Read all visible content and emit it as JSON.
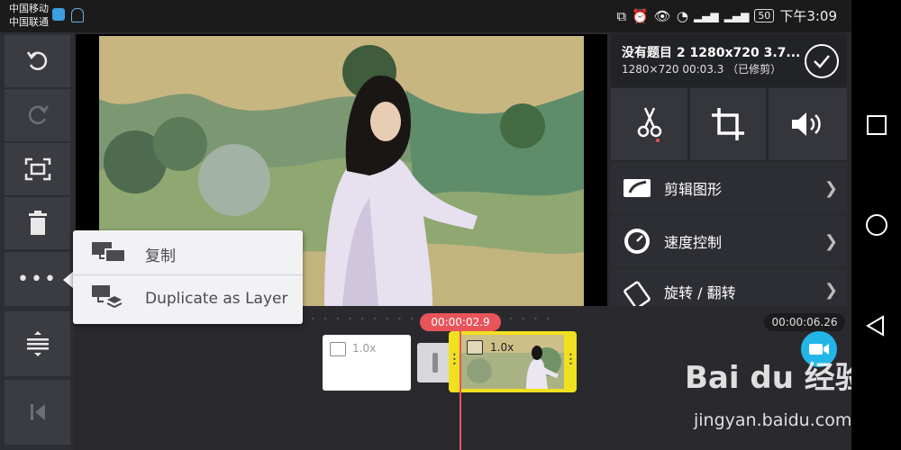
{
  "status_bar": {
    "carrier_1": "中国移动",
    "carrier_2": "中国联通",
    "battery": "50",
    "time": "下午3:09"
  },
  "toolbar": {
    "undo_icon": "undo-icon",
    "redo_icon": "redo-icon",
    "fit_icon": "fit-screen-icon",
    "delete_icon": "trash-icon",
    "more_icon": "more-dots-icon",
    "split_icon": "split-view-icon",
    "back_icon": "skip-to-start-icon"
  },
  "project": {
    "title": "没有题目 2 1280x720 3.7...",
    "info": "1280×720  00:03.3  （已修剪）"
  },
  "quick_actions": [
    "scissors-icon",
    "crop-icon",
    "volume-icon"
  ],
  "menu": [
    {
      "label": "剪辑图形",
      "icon": "clip-graphics-icon"
    },
    {
      "label": "速度控制",
      "icon": "speedometer-icon"
    },
    {
      "label": "旋转 / 翻转",
      "icon": "rotate-icon"
    }
  ],
  "popup": {
    "items": [
      {
        "label": "复制",
        "icon": "duplicate-icon"
      },
      {
        "label": "Duplicate as Layer",
        "icon": "duplicate-layer-icon"
      }
    ]
  },
  "timeline": {
    "playhead_time": "00:00:02.9",
    "total_time": "00:00:06.26",
    "clip1_speed": "1.0x",
    "clip2_speed": "1.0x"
  },
  "watermark": {
    "text": "Bai du 经验",
    "url": "jingyan.baidu.com"
  },
  "colors": {
    "accent_red": "#e8545a",
    "selected_clip": "#f0e020",
    "record_blue": "#22b6e8"
  }
}
